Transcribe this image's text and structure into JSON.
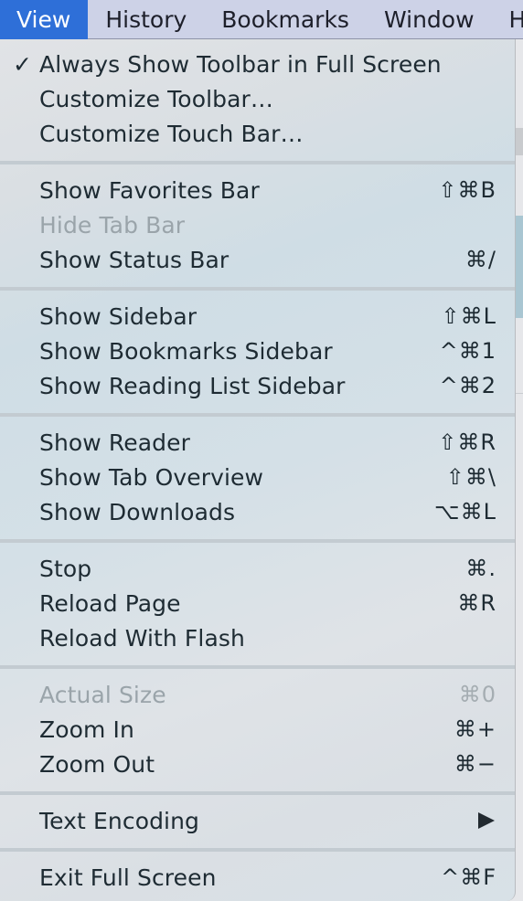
{
  "menubar": {
    "items": [
      {
        "label": "View",
        "active": true
      },
      {
        "label": "History"
      },
      {
        "label": "Bookmarks"
      },
      {
        "label": "Window"
      },
      {
        "label": "H"
      }
    ]
  },
  "colors": {
    "menubar_bg": "#cdd2e7",
    "active_menu_bg": "#2e6fd8",
    "text": "#1e2b33",
    "disabled_text": "#9aa4aa"
  },
  "view_menu": {
    "groups": [
      [
        {
          "label": "Always Show Toolbar in Full Screen",
          "checked": true,
          "shortcut": ""
        },
        {
          "label": "Customize Toolbar…",
          "shortcut": ""
        },
        {
          "label": "Customize Touch Bar…",
          "shortcut": ""
        }
      ],
      [
        {
          "label": "Show Favorites Bar",
          "shortcut": "⇧⌘B"
        },
        {
          "label": "Hide Tab Bar",
          "shortcut": "",
          "disabled": true
        },
        {
          "label": "Show Status Bar",
          "shortcut": "⌘/"
        }
      ],
      [
        {
          "label": "Show Sidebar",
          "shortcut": "⇧⌘L"
        },
        {
          "label": "Show Bookmarks Sidebar",
          "shortcut": "^⌘1"
        },
        {
          "label": "Show Reading List Sidebar",
          "shortcut": "^⌘2"
        }
      ],
      [
        {
          "label": "Show Reader",
          "shortcut": "⇧⌘R"
        },
        {
          "label": "Show Tab Overview",
          "shortcut": "⇧⌘\\"
        },
        {
          "label": "Show Downloads",
          "shortcut": "⌥⌘L"
        }
      ],
      [
        {
          "label": "Stop",
          "shortcut": "⌘."
        },
        {
          "label": "Reload Page",
          "shortcut": "⌘R"
        },
        {
          "label": "Reload With Flash",
          "shortcut": ""
        }
      ],
      [
        {
          "label": "Actual Size",
          "shortcut": "⌘0",
          "disabled": true
        },
        {
          "label": "Zoom In",
          "shortcut": "⌘+"
        },
        {
          "label": "Zoom Out",
          "shortcut": "⌘−"
        }
      ],
      [
        {
          "label": "Text Encoding",
          "shortcut": "",
          "submenu": true
        }
      ],
      [
        {
          "label": "Exit Full Screen",
          "shortcut": "^⌘F"
        }
      ]
    ],
    "check_glyph": "✓"
  }
}
